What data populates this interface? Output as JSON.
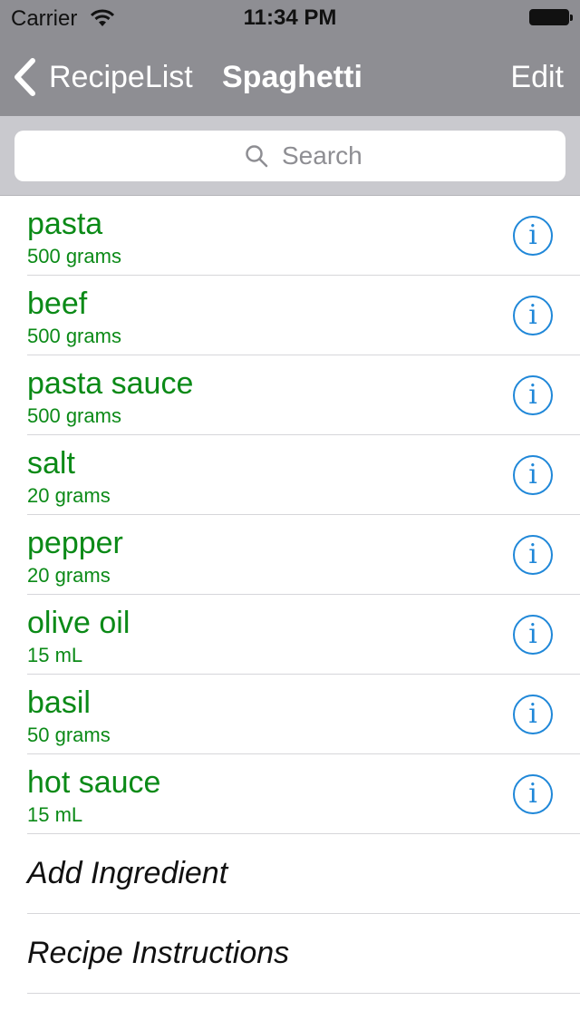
{
  "status_bar": {
    "carrier": "Carrier",
    "time": "11:34 PM"
  },
  "nav_bar": {
    "back_label": "RecipeList",
    "title": "Spaghetti",
    "edit_label": "Edit"
  },
  "search": {
    "placeholder": "Search"
  },
  "ingredients": [
    {
      "name": "pasta",
      "quantity": "500 grams"
    },
    {
      "name": "beef",
      "quantity": "500 grams"
    },
    {
      "name": "pasta sauce",
      "quantity": "500 grams"
    },
    {
      "name": "salt",
      "quantity": "20 grams"
    },
    {
      "name": "pepper",
      "quantity": "20 grams"
    },
    {
      "name": "olive oil",
      "quantity": "15 mL"
    },
    {
      "name": "basil",
      "quantity": "50 grams"
    },
    {
      "name": "hot sauce",
      "quantity": "15 mL"
    }
  ],
  "info_glyph": "i",
  "actions": {
    "add_ingredient": "Add Ingredient",
    "recipe_instructions": "Recipe Instructions"
  },
  "colors": {
    "ingredient_text": "#0b8a17",
    "info_accent": "#1f87d8",
    "nav_bar": "#8e8e93"
  }
}
